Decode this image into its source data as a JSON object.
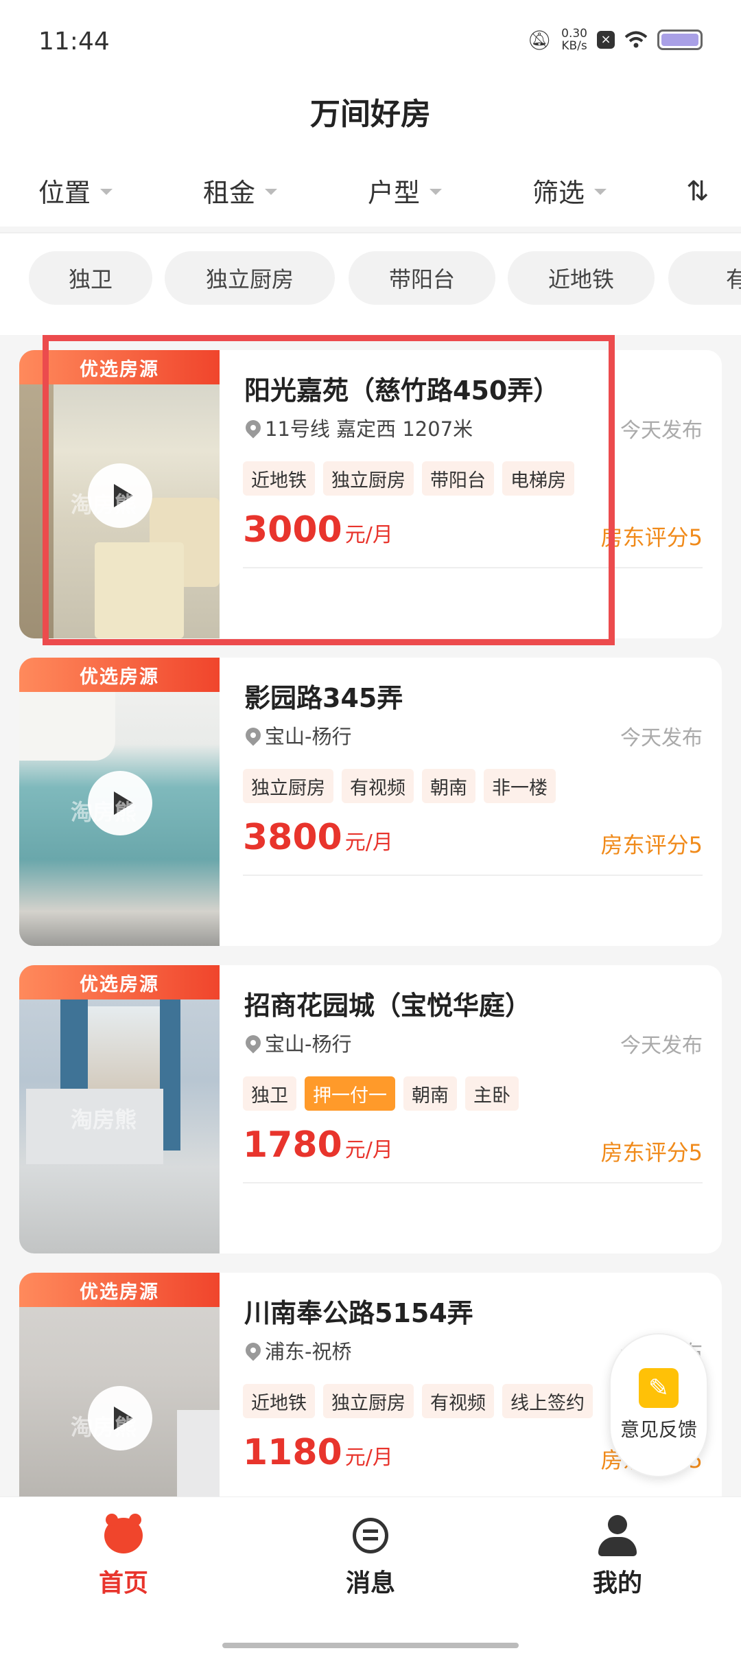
{
  "status_bar": {
    "time": "11:44",
    "net_speed": "0.30",
    "net_unit": "KB/s",
    "icons": [
      "bell-off-icon",
      "x-box-icon",
      "wifi-icon",
      "battery-icon"
    ]
  },
  "header": {
    "title": "万间好房",
    "filters": [
      "位置",
      "租金",
      "户型",
      "筛选"
    ],
    "sort_icon": "⇅"
  },
  "chips": [
    "独卫",
    "独立厨房",
    "带阳台",
    "近地铁",
    "有"
  ],
  "colors": {
    "accent": "#e8342c",
    "badge_gradient": [
      "#ff8a5c",
      "#f0452c"
    ],
    "rating": "#f08a1a",
    "highlight_box": "#ec4b4d",
    "highlight_tag": "#ff9a2a"
  },
  "listings": [
    {
      "badge": "优选房源",
      "title": "阳光嘉苑（慈竹路450弄）",
      "location": "11号线 嘉定西 1207米",
      "time": "今天发布",
      "tags": [
        "近地铁",
        "独立厨房",
        "带阳台",
        "电梯房"
      ],
      "price": "3000",
      "price_unit": "元/月",
      "rating": "房东评分5",
      "watermark": "淘房熊"
    },
    {
      "badge": "优选房源",
      "title": "影园路345弄",
      "location": "宝山-杨行",
      "time": "今天发布",
      "tags": [
        "独立厨房",
        "有视频",
        "朝南",
        "非一楼"
      ],
      "price": "3800",
      "price_unit": "元/月",
      "rating": "房东评分5",
      "watermark": "淘房熊"
    },
    {
      "badge": "优选房源",
      "title": "招商花园城（宝悦华庭）",
      "location": "宝山-杨行",
      "time": "今天发布",
      "tags": [
        "独卫",
        "押一付一",
        "朝南",
        "主卧"
      ],
      "price": "1780",
      "price_unit": "元/月",
      "rating": "房东评分5",
      "watermark": "淘房熊"
    },
    {
      "badge": "优选房源",
      "title": "川南奉公路5154弄",
      "location": "浦东-祝桥",
      "time": "今天发布",
      "tags": [
        "近地铁",
        "独立厨房",
        "有视频",
        "线上签约"
      ],
      "price": "1180",
      "price_unit": "元/月",
      "rating": "房东评分5",
      "watermark": "淘房熊"
    }
  ],
  "feedback": {
    "label": "意见反馈",
    "icon": "edit-icon"
  },
  "tabbar": {
    "home": "首页",
    "messages": "消息",
    "profile": "我的"
  }
}
